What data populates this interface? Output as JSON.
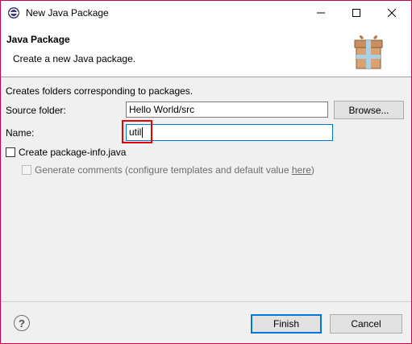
{
  "window": {
    "title": "New Java Package"
  },
  "header": {
    "title": "Java Package",
    "subtitle": "Create a new Java package."
  },
  "content": {
    "description": "Creates folders corresponding to packages.",
    "source_folder_label": "Source folder:",
    "source_folder_value": "Hello World/src",
    "browse_label": "Browse...",
    "name_label": "Name:",
    "name_value": "util",
    "create_info_label": "Create package-info.java",
    "create_info_checked": false,
    "generate_comments_prefix": "Generate comments (configure templates and default value ",
    "generate_comments_link": "here",
    "generate_comments_suffix": ")",
    "generate_comments_enabled": false
  },
  "footer": {
    "finish_label": "Finish",
    "cancel_label": "Cancel",
    "help_icon": "?"
  },
  "icons": {
    "app": "eclipse-icon",
    "package": "package-icon",
    "minimize": "minimize-icon",
    "maximize": "maximize-icon",
    "close": "close-icon",
    "help": "help-icon"
  },
  "colors": {
    "accent": "#0078d7",
    "highlight": "#e60000",
    "window_border": "#c4004a"
  }
}
